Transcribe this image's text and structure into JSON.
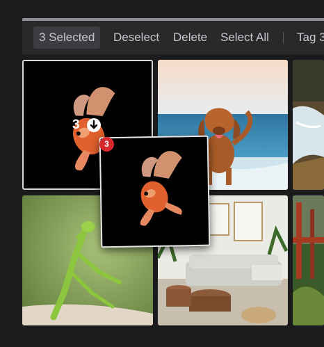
{
  "toolbar": {
    "selected_label": "3 Selected",
    "deselect_label": "Deselect",
    "delete_label": "Delete",
    "select_all_label": "Select All",
    "tag_label": "Tag 3"
  },
  "selection": {
    "count_label": "3",
    "drag_badge": "3"
  },
  "icons": {
    "download": "download-icon"
  },
  "colors": {
    "badge": "#d6282d",
    "toolbar": "#29292c",
    "background": "#1b1b1d"
  }
}
